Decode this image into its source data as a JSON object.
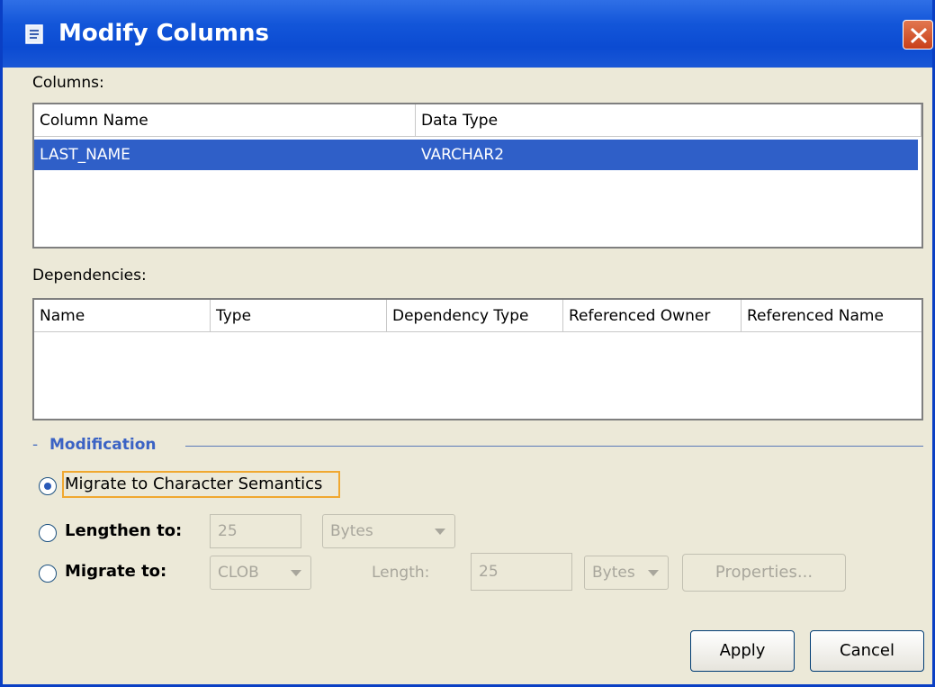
{
  "dialog": {
    "title": "Modify Columns",
    "close_symbol": "×"
  },
  "columns": {
    "label": "Columns:",
    "headers": [
      "Column Name",
      "Data Type"
    ],
    "rows": [
      {
        "column_name": "LAST_NAME",
        "data_type": "VARCHAR2",
        "selected": true
      }
    ]
  },
  "dependencies": {
    "label": "Dependencies:",
    "headers": [
      "Name",
      "Type",
      "Dependency Type",
      "Referenced Owner",
      "Referenced Name"
    ]
  },
  "modification": {
    "title": "Modification",
    "dash": "-",
    "options": {
      "migrate_char": {
        "label": "Migrate to Character Semantics",
        "selected": true
      },
      "lengthen": {
        "label": "Lengthen to:",
        "value": "25",
        "unit": "Bytes",
        "selected": false
      },
      "migrate_to": {
        "label": "Migrate to:",
        "type": "CLOB",
        "length_label": "Length:",
        "length": "25",
        "unit": "Bytes",
        "properties_label": "Properties...",
        "selected": false
      }
    }
  },
  "buttons": {
    "apply": "Apply",
    "cancel": "Cancel"
  },
  "colors": {
    "titlebar": "#0b4bd2",
    "selection": "#2f5fc8",
    "dialog_bg": "#ece9d8",
    "close": "#c8401a"
  }
}
